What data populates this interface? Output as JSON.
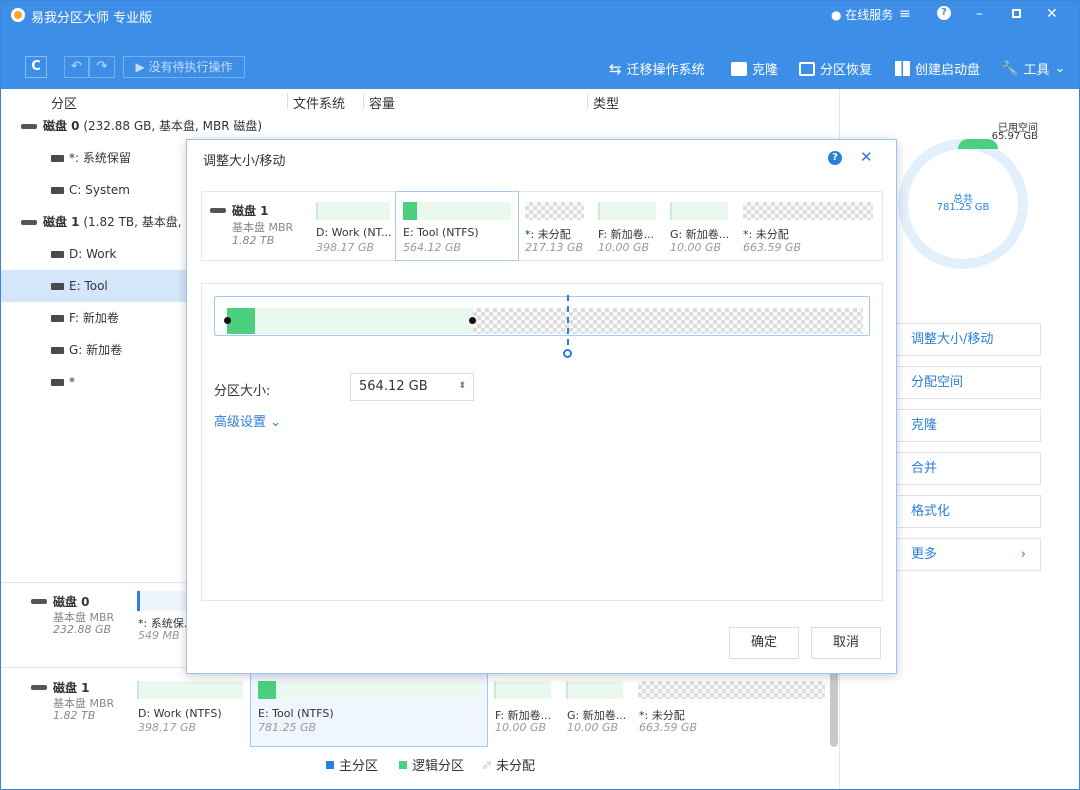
{
  "app": {
    "title": "易我分区大师 专业版",
    "online_service": "在线服务"
  },
  "toolbar": {
    "refresh": "C",
    "undo": "↶",
    "redo": "↷",
    "pending": "▶ 没有待执行操作",
    "migrate_os": "迁移操作系统",
    "clone": "克隆",
    "recover": "分区恢复",
    "boot_disk": "创建启动盘",
    "tools": "工具"
  },
  "columns": {
    "partition": "分区",
    "fs": "文件系统",
    "capacity": "容量",
    "type": "类型"
  },
  "tree": [
    {
      "label": "磁盘 0",
      "detail": "(232.88 GB, 基本盘, MBR 磁盘)"
    },
    {
      "label": "*: 系统保留"
    },
    {
      "label": "C: System"
    },
    {
      "label": "磁盘 1",
      "detail": "(1.82 TB, 基本盘,"
    },
    {
      "label": "D: Work"
    },
    {
      "label": "E: Tool"
    },
    {
      "label": "F: 新加卷"
    },
    {
      "label": "G: 新加卷"
    },
    {
      "label": "*"
    }
  ],
  "right_panel": {
    "used_label": "已用空间",
    "used_value": "65.97 GB",
    "total_label": "总共",
    "total_value": "781.25 GB",
    "actions": [
      "调整大小/移动",
      "分配空间",
      "克隆",
      "合并",
      "格式化",
      "更多"
    ],
    "more_arrow": "›"
  },
  "dialog": {
    "title": "调整大小/移动",
    "disk_name": "磁盘 1",
    "disk_type": "基本盘 MBR",
    "disk_size": "1.82 TB",
    "segments": [
      {
        "name": "D: Work (NT...",
        "size": "398.17 GB"
      },
      {
        "name": "E: Tool (NTFS)",
        "size": "564.12 GB"
      },
      {
        "name": "*: 未分配",
        "size": "217.13 GB"
      },
      {
        "name": "F: 新加卷...",
        "size": "10.00 GB"
      },
      {
        "name": "G: 新加卷...",
        "size": "10.00 GB"
      },
      {
        "name": "*: 未分配",
        "size": "663.59 GB"
      }
    ],
    "size_label": "分区大小:",
    "size_value": "564.12 GB",
    "advanced": "高级设置",
    "ok": "确定",
    "cancel": "取消"
  },
  "bottom": {
    "disk0": {
      "name": "磁盘 0",
      "type": "基本盘 MBR",
      "size": "232.88 GB",
      "p1_name": "*: 系统保...",
      "p1_size": "549 MB"
    },
    "disk1": {
      "name": "磁盘 1",
      "type": "基本盘 MBR",
      "size": "1.82 TB",
      "parts": [
        {
          "name": "D: Work (NTFS)",
          "size": "398.17 GB"
        },
        {
          "name": "E: Tool (NTFS)",
          "size": "781.25 GB"
        },
        {
          "name": "F: 新加卷...",
          "size": "10.00 GB"
        },
        {
          "name": "G: 新加卷...",
          "size": "10.00 GB"
        },
        {
          "name": "*: 未分配",
          "size": "663.59 GB"
        }
      ]
    }
  },
  "legend": {
    "primary": "主分区",
    "logical": "逻辑分区",
    "unalloc": "未分配"
  },
  "colors": {
    "brand": "#3d8ee6",
    "logical": "#4cd080",
    "primary": "#2f7ee0"
  }
}
